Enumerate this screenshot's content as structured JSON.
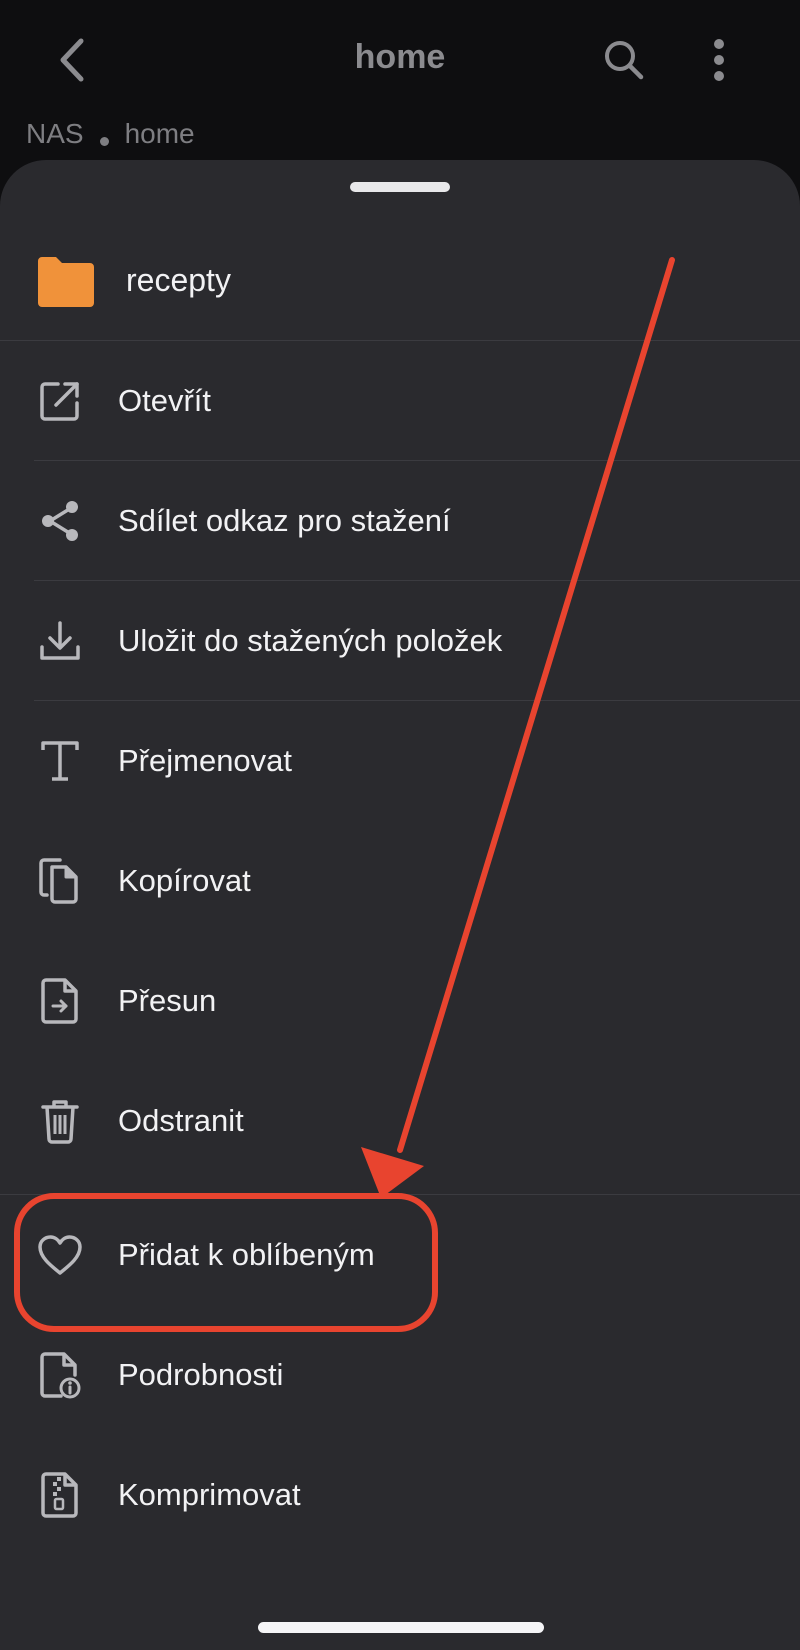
{
  "topbar": {
    "title": "home",
    "back_icon": "chevron-left-icon",
    "search_icon": "search-icon",
    "more_icon": "more-vertical-icon"
  },
  "breadcrumb": [
    "NAS",
    "home"
  ],
  "sheet": {
    "folder_name": "recepty",
    "folder_color": "#f0923a",
    "items": [
      {
        "label": "Otevřít",
        "icon": "open-external-icon"
      },
      {
        "label": "Sdílet odkaz pro stažení",
        "icon": "share-icon"
      },
      {
        "label": "Uložit do stažených položek",
        "icon": "download-icon"
      },
      {
        "label": "Přejmenovat",
        "icon": "text-rename-icon"
      },
      {
        "label": "Kopírovat",
        "icon": "copy-icon"
      },
      {
        "label": "Přesun",
        "icon": "move-file-icon"
      },
      {
        "label": "Odstranit",
        "icon": "trash-icon"
      },
      {
        "label": "Přidat k oblíbeným",
        "icon": "heart-icon"
      },
      {
        "label": "Podrobnosti",
        "icon": "file-info-icon"
      },
      {
        "label": "Komprimovat",
        "icon": "zip-file-icon"
      }
    ]
  },
  "annotation": {
    "color": "#e8442f",
    "highlighted_item": "Přidat k oblíbeným"
  }
}
